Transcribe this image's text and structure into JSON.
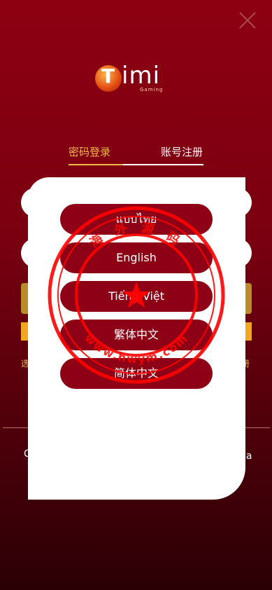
{
  "header": {
    "close_icon": "close-icon"
  },
  "logo": {
    "brand": "Timi",
    "sub": "Gaming"
  },
  "tabs": {
    "login": "密码登录",
    "register": "账号注册"
  },
  "background": {
    "left_text": "选",
    "right_text": "册",
    "bottom_left": "C",
    "bottom_right": "la"
  },
  "languages": [
    "แบบไทย",
    "English",
    "Tiếng Việt",
    "繁体中文",
    "简体中文"
  ],
  "watermark": {
    "top_text": "海 外 源 码",
    "bottom_text": "www.hwym.com"
  },
  "colors": {
    "accent": "#f1b84b",
    "button": "#8e0015",
    "stamp": "#ff0000"
  }
}
